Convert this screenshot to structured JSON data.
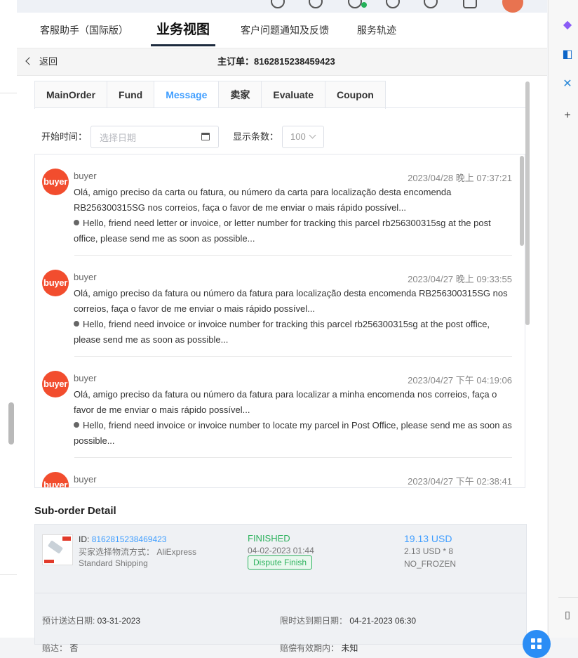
{
  "header_tabs": [
    {
      "label": "客服助手（国际版）"
    },
    {
      "label": "业务视图"
    },
    {
      "label": "客户问题通知及反馈"
    },
    {
      "label": "服务轨迹"
    }
  ],
  "subheader": {
    "back_label": "返回",
    "order_title": "主订单：8162815238459423"
  },
  "tabs": [
    "MainOrder",
    "Fund",
    "Message",
    "卖家",
    "Evaluate",
    "Coupon"
  ],
  "active_tab": "Message",
  "filter": {
    "start_time_label": "开始时间：",
    "date_placeholder": "选择日期",
    "count_label": "显示条数：",
    "count_value": "100"
  },
  "messages": [
    {
      "avatar": "buyer",
      "sender": "buyer",
      "time": "2023/04/28 晚上 07:37:21",
      "original": "Olá, amigo preciso da carta ou fatura, ou número da carta para localização desta encomenda RB256300315SG nos correios, faça o favor de me enviar o mais rápido possível...",
      "translation": "Hello, friend need letter or invoice, or letter number for tracking this parcel rb256300315sg at the post office, please send me as soon as possible..."
    },
    {
      "avatar": "buyer",
      "sender": "buyer",
      "time": "2023/04/27 晚上 09:33:55",
      "original": "Olá, amigo preciso da fatura ou número da fatura para localização desta encomenda RB256300315SG nos correios, faça o favor de me enviar o mais rápido possível...",
      "translation": "Hello, friend need invoice or invoice number for tracking this parcel rb256300315sg at the post office, please send me as soon as possible..."
    },
    {
      "avatar": "buyer",
      "sender": "buyer",
      "time": "2023/04/27 下午 04:19:06",
      "original": "Olá, amigo preciso da fatura ou número da fatura para localizar a minha encomenda nos correios, faça o favor de me enviar o mais rápido possível...",
      "translation": "Hello, friend need invoice or invoice number to locate my parcel in Post Office, please send me as soon as possible..."
    },
    {
      "avatar": "buyer",
      "sender": "buyer",
      "time": "2023/04/27 下午 02:38:41",
      "original": "",
      "translation": ""
    }
  ],
  "sub_order": {
    "title": "Sub-order Detail",
    "id_label": "ID:",
    "id": "8162815238469423",
    "shipping": "买家选择物流方式： AliExpress Standard Shipping",
    "status": "FINISHED",
    "status_date": "04-02-2023 01:44",
    "dispute": "Dispute Finish",
    "price": "19.13 USD",
    "unit": "2.13 USD * 8",
    "frozen": "NO_FROZEN",
    "expected_label": "预计送达日期: ",
    "expected": "03-31-2023",
    "deadline_label": "限时达到期日期： ",
    "deadline": "04-21-2023 06:30",
    "row3_left_label": "赔达： ",
    "row3_left": "否",
    "row3_right_label": "赔偿有效期内： ",
    "row3_right": "未知"
  },
  "colors": {
    "accent": "#409eff",
    "success": "#2fb35f",
    "avatar": "#f24d2e"
  }
}
